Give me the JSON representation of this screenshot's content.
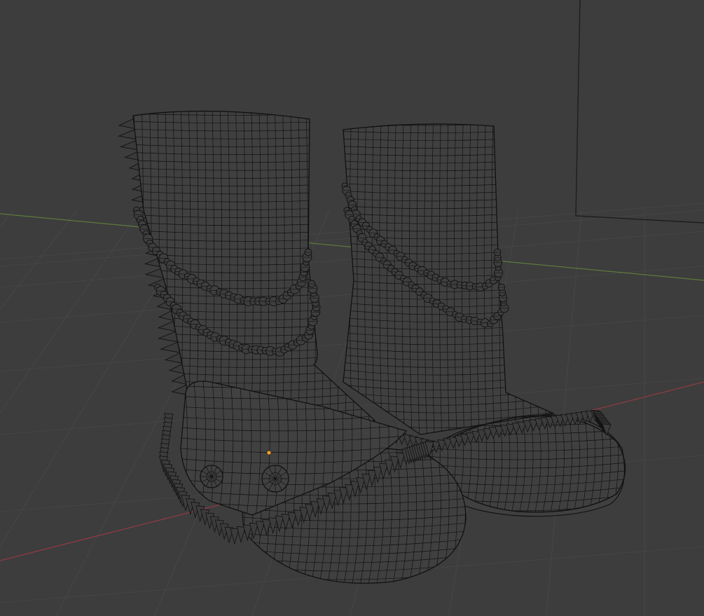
{
  "viewport": {
    "background": "#3d3d3d",
    "grid_color": "#4a4a4a",
    "x_axis_color": "#8a3a44",
    "y_axis_color": "#5d7a3a",
    "wire_color": "#111111",
    "mesh_fill": "#404040",
    "origin_color": "#f0a030",
    "camera_frame_color": "#1e1e1e"
  },
  "scene": {
    "objects": [
      {
        "name": "boot-left"
      },
      {
        "name": "boot-right"
      }
    ],
    "origin_marker": "object-origin-point",
    "camera": "camera-frame"
  }
}
